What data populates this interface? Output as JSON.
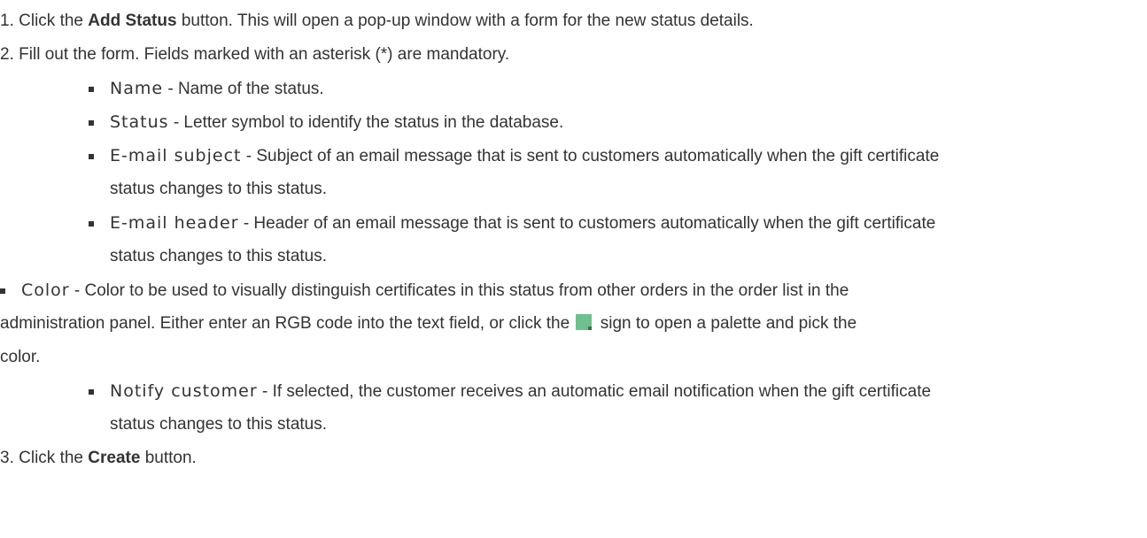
{
  "steps": {
    "s1": {
      "num": "1.",
      "pre": "Click the ",
      "bold": "Add Status",
      "post": " button. This will open a pop-up window with a form for the new status details."
    },
    "s2": {
      "num": "2.",
      "text": "Fill out the form. Fields marked with an asterisk (*) are mandatory."
    },
    "s3": {
      "num": "3.",
      "pre": "Click the ",
      "bold": "Create",
      "post": " button."
    }
  },
  "fields": {
    "name": {
      "term": "Name",
      "desc": " - Name of the status."
    },
    "status": {
      "term": "Status",
      "desc": " - Letter symbol to identify the status in the database."
    },
    "email_subject": {
      "term": "E-mail subject",
      "desc_1": " - Subject of an email message that is sent to customers automatically when the gift certificate",
      "desc_2": "status changes to this status."
    },
    "email_header": {
      "term": "E-mail header",
      "desc_1": " - Header of an email message that is sent to customers automatically when the gift certificate",
      "desc_2": "status changes to this status."
    },
    "color": {
      "term": "Color",
      "desc_1": " - Color to be used to visually distinguish certificates in this status from other orders in the order list in the",
      "desc_2a": "administration panel. Either enter an RGB code into the text field, or click the ",
      "desc_2b": " sign to open a palette and pick the",
      "desc_3": "color.",
      "icon": "color-picker-icon",
      "icon_color": "#6fc08e"
    },
    "notify": {
      "term": "Notify customer",
      "desc_1": " - If selected, the customer receives an automatic email notification when the gift certificate",
      "desc_2": "status changes to this status."
    }
  }
}
